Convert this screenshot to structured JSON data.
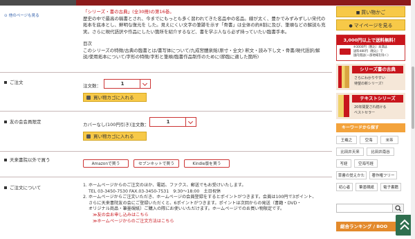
{
  "header": {
    "back_link": "他のページも見る"
  },
  "description": {
    "lines": [
      "「シリーズ・書の古典」(全30冊)の第16巻。",
      "歴史の中で最高の稿書とされ、今までにもっとも多く習われてきた名品中の名品。線が太く、豊かでみずみずしい宋代の",
      "拓本を底本とし、鮮明な復元を した。見えにくい文字の筆跡を示す「骨書」は全体の約8割に及び、筆順などの解説も充",
      "実。さらに現代語訳や作品にしたい箇所を紹介するなど、書を学ぶ人なら必ず持っていたい臨書手本。"
    ],
    "toc_title": "目次",
    "toc_lines": [
      "このシリーズの特徴/古典の臨書とは/書写体について/九成宮醴泉銘(原寸・全文) 釈文・読み下し文・骨書/現代語訳/解",
      "説/使用拓本について/字形の特徴/字形と筆順/臨書作品制作のために(節臨に適した箇所)"
    ]
  },
  "order": {
    "section_label": "ご注文",
    "qty_label": "注文数：",
    "qty_value": "1",
    "cart_label": "買い物カゴに入れる"
  },
  "member": {
    "section_label": "友の会会員限定",
    "qty_label": "カバーなし(100円引き)注文数：",
    "qty_value": "1",
    "cart_label": "買い物カゴに入れる"
  },
  "other_stores": {
    "section_label": "天来書院以外で買う",
    "amazon": "Amazonで買う",
    "seven": "セブンネットで買う",
    "kindle": "Kindle版を買う"
  },
  "about_order": {
    "section_label": "ご注文について",
    "line1": "1. ホームページからのご注文のほか、電話、ファクス、郵送でもお受けいたします。",
    "line2": "TEL 03-3450-7530 FAX.03-3450-7531　9:30～18:00　土日祝休",
    "line3": "2. ホームページからご注文いただき、ホームページの会員登録をするとポイントがつきます。会員は100円で3ポイント、",
    "line4": "さらに天来書院友の会にご登録いただくと、6ポイントがつきます。ポイントは次回からの発送（書籍・DVD・",
    "line5": "オリジナル商品・筆墨硯紙）ご購入の際にお使いいただけます。ホームページでのお買い物限定です。",
    "link1": "≫友の会お申し込みはこちら",
    "link2": "≫ホームページからのご注文方法はこちら"
  },
  "sidebar": {
    "cart_btn": "買い物かご",
    "mypage_btn": "マイページを見る",
    "shipping_main": "3,000円以上で送料無料！",
    "shipping_sub1": "※3000円（税込）未満は",
    "shipping_sub2": "送料480円（税込）で",
    "shipping_sub3": "国内発送(一部地域を除く)",
    "series_title": "シリーズ書の古典",
    "series_sub1": "さらにわかりやすい",
    "series_sub2": "待望の新シリーズ！",
    "text_title": "テキストシリーズ",
    "text_sub1": "20年間愛され続ける",
    "text_sub2": "ベストセラー",
    "keyword_head": "キーワードから探す",
    "keywords": [
      [
        "王羲之",
        "空海",
        "米芾"
      ],
      [
        "比田井天来",
        "比田井南谷"
      ],
      [
        "写経",
        "空海写経"
      ],
      [
        "草書の覚えかた",
        "著作権フリー"
      ],
      [
        "初心者",
        "筆墨硯紙",
        "電子書籍"
      ]
    ],
    "ranking_head": "総合ランキング / BOO"
  },
  "colors": {
    "accent": "#c8161d",
    "button": "#f7c948",
    "keyword_head": "#f3a33c",
    "scroll_top": "#2f6f4f"
  }
}
